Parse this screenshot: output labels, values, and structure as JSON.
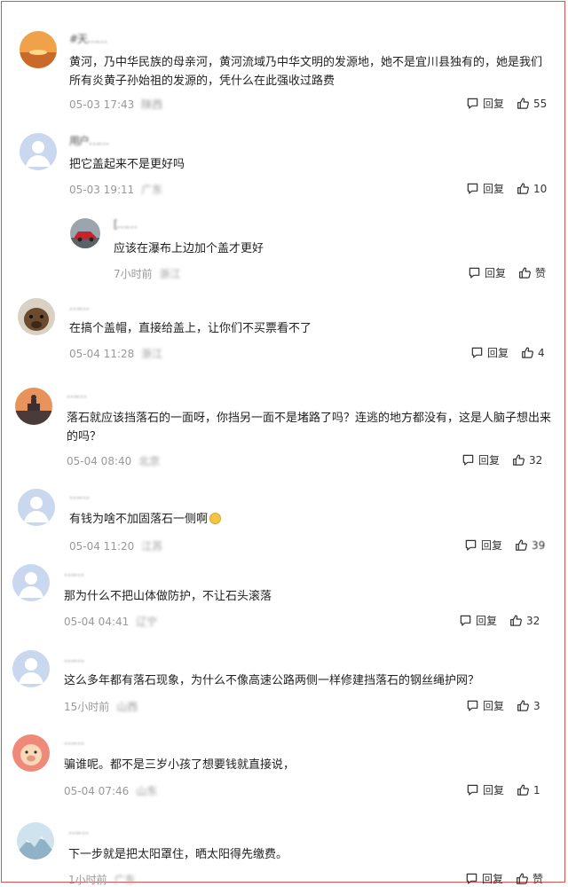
{
  "reply_label": "回复",
  "comments": [
    {
      "user": "#天……",
      "text": "黄河，乃中华民族的母亲河，黄河流域乃中华文明的发源地，她不是宜川县独有的，她是我们所有炎黄子孙始祖的发源的，凭什么在此强收过路费",
      "time": "05-03 17:43",
      "location": "陕西",
      "likes": "55",
      "avatar_icon": "sunset-avatar"
    },
    {
      "user": "用户……",
      "text": "把它盖起来不是更好吗",
      "time": "05-03 19:11",
      "location": "广东",
      "likes": "10",
      "avatar_icon": "default-user-avatar"
    },
    {
      "user": "[……",
      "text": "应该在瀑布上边加个盖才更好",
      "time": "7小时前",
      "location": "浙江",
      "likes": "赞",
      "avatar_icon": "red-car-avatar"
    },
    {
      "user": "……",
      "text": "在搞个盖帽，直接给盖上，让你们不买票看不了",
      "time": "05-04 11:28",
      "location": "浙江",
      "likes": "4",
      "avatar_icon": "dog-avatar"
    },
    {
      "user": "……",
      "text": "落石就应该挡落石的一面呀，你挡另一面不是堵路了吗？连逃的地方都没有，这是人脑子想出来的吗？",
      "time": "05-04 08:40",
      "location": "北京",
      "likes": "32",
      "avatar_icon": "city-dusk-avatar"
    },
    {
      "user": "……",
      "text": "有钱为啥不加固落石一侧啊",
      "time": "05-04 11:20",
      "location": "江苏",
      "likes": "39",
      "avatar_icon": "default-user-avatar"
    },
    {
      "user": "……",
      "text": "那为什么不把山体做防护，不让石头滚落",
      "time": "05-04 04:41",
      "location": "辽宁",
      "likes": "32",
      "avatar_icon": "default-user-avatar"
    },
    {
      "user": "……",
      "text": "这么多年都有落石现象，为什么不像高速公路两侧一样修建挡落石的钢丝绳护网？",
      "time": "15小时前",
      "location": "山西",
      "likes": "3",
      "avatar_icon": "default-user-avatar"
    },
    {
      "user": "……",
      "text": "骗谁呢。都不是三岁小孩了想要钱就直接说，",
      "time": "05-04 07:46",
      "location": "山东",
      "likes": "1",
      "avatar_icon": "pig-cartoon-avatar"
    },
    {
      "user": "……",
      "text": "下一步就是把太阳罩住，晒太阳得先缴费。",
      "time": "1小时前",
      "location": "广东",
      "likes": "赞",
      "avatar_icon": "mountain-avatar"
    }
  ]
}
